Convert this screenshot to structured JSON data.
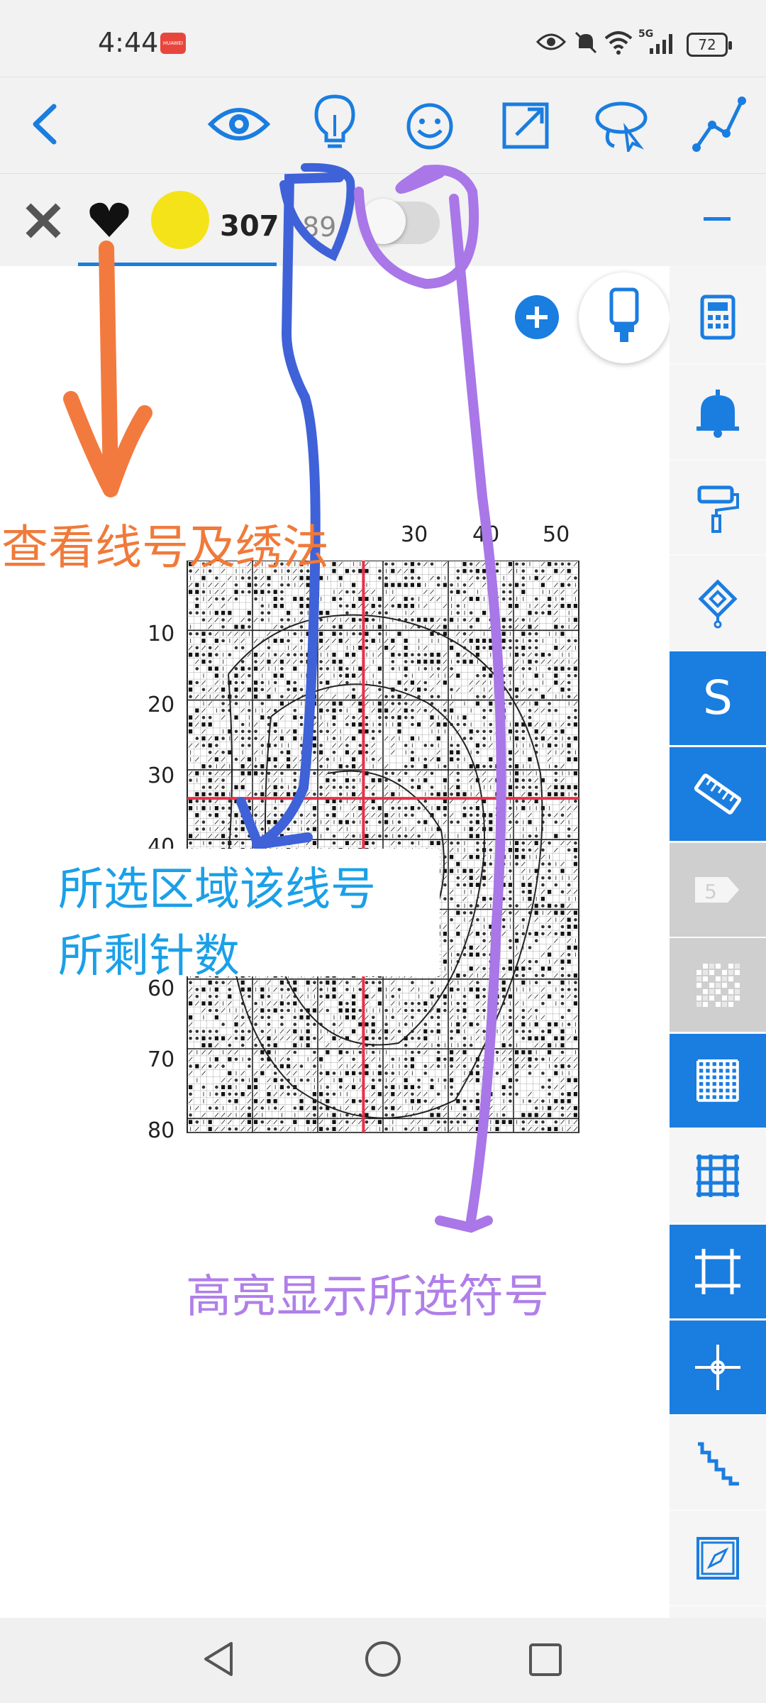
{
  "status_bar": {
    "time": "4:44",
    "app_badge": "HUAWEI",
    "network": "5G",
    "battery": "72"
  },
  "toolbar": {
    "icons": [
      "back-icon",
      "eye-icon",
      "lightbulb-icon",
      "smiley-icon",
      "expand-icon",
      "lasso-icon",
      "polyline-icon"
    ]
  },
  "thread_bar": {
    "primary_count": "307",
    "secondary_count": "89",
    "symbol": "heart",
    "color_swatch": "#f5e31a",
    "accent": "#1a7de0"
  },
  "chart": {
    "x_ticks": [
      "30",
      "40",
      "50"
    ],
    "y_ticks": [
      "10",
      "20",
      "30",
      "40",
      "60",
      "70",
      "80"
    ],
    "highlight_color": "#e8314a"
  },
  "annotations": {
    "view_thread": "查看线号及绣法",
    "remaining_line1": "所选区域该线号",
    "remaining_line2": "所剩针数",
    "highlight_symbol": "高亮显示所选符号"
  },
  "right_panel": {
    "items": [
      {
        "icon": "calculator-icon",
        "state": "normal"
      },
      {
        "icon": "bell-icon",
        "state": "normal"
      },
      {
        "icon": "paint-roller-icon",
        "state": "normal"
      },
      {
        "icon": "diamond-pin-icon",
        "state": "normal"
      },
      {
        "icon": "s-icon",
        "label": "S",
        "state": "active"
      },
      {
        "icon": "ruler-icon",
        "state": "active"
      },
      {
        "icon": "tag-icon",
        "label": "5",
        "state": "disabled"
      },
      {
        "icon": "checker-icon",
        "state": "disabled"
      },
      {
        "icon": "fine-grid-icon",
        "state": "active"
      },
      {
        "icon": "grid-icon",
        "state": "normal"
      },
      {
        "icon": "frame-icon",
        "state": "active"
      },
      {
        "icon": "crosshair-icon",
        "state": "active"
      },
      {
        "icon": "stairs-icon",
        "state": "normal"
      },
      {
        "icon": "compass-icon",
        "state": "normal"
      }
    ]
  },
  "nav_bar": {
    "icons": [
      "nav-back-icon",
      "nav-home-icon",
      "nav-recents-icon"
    ]
  }
}
